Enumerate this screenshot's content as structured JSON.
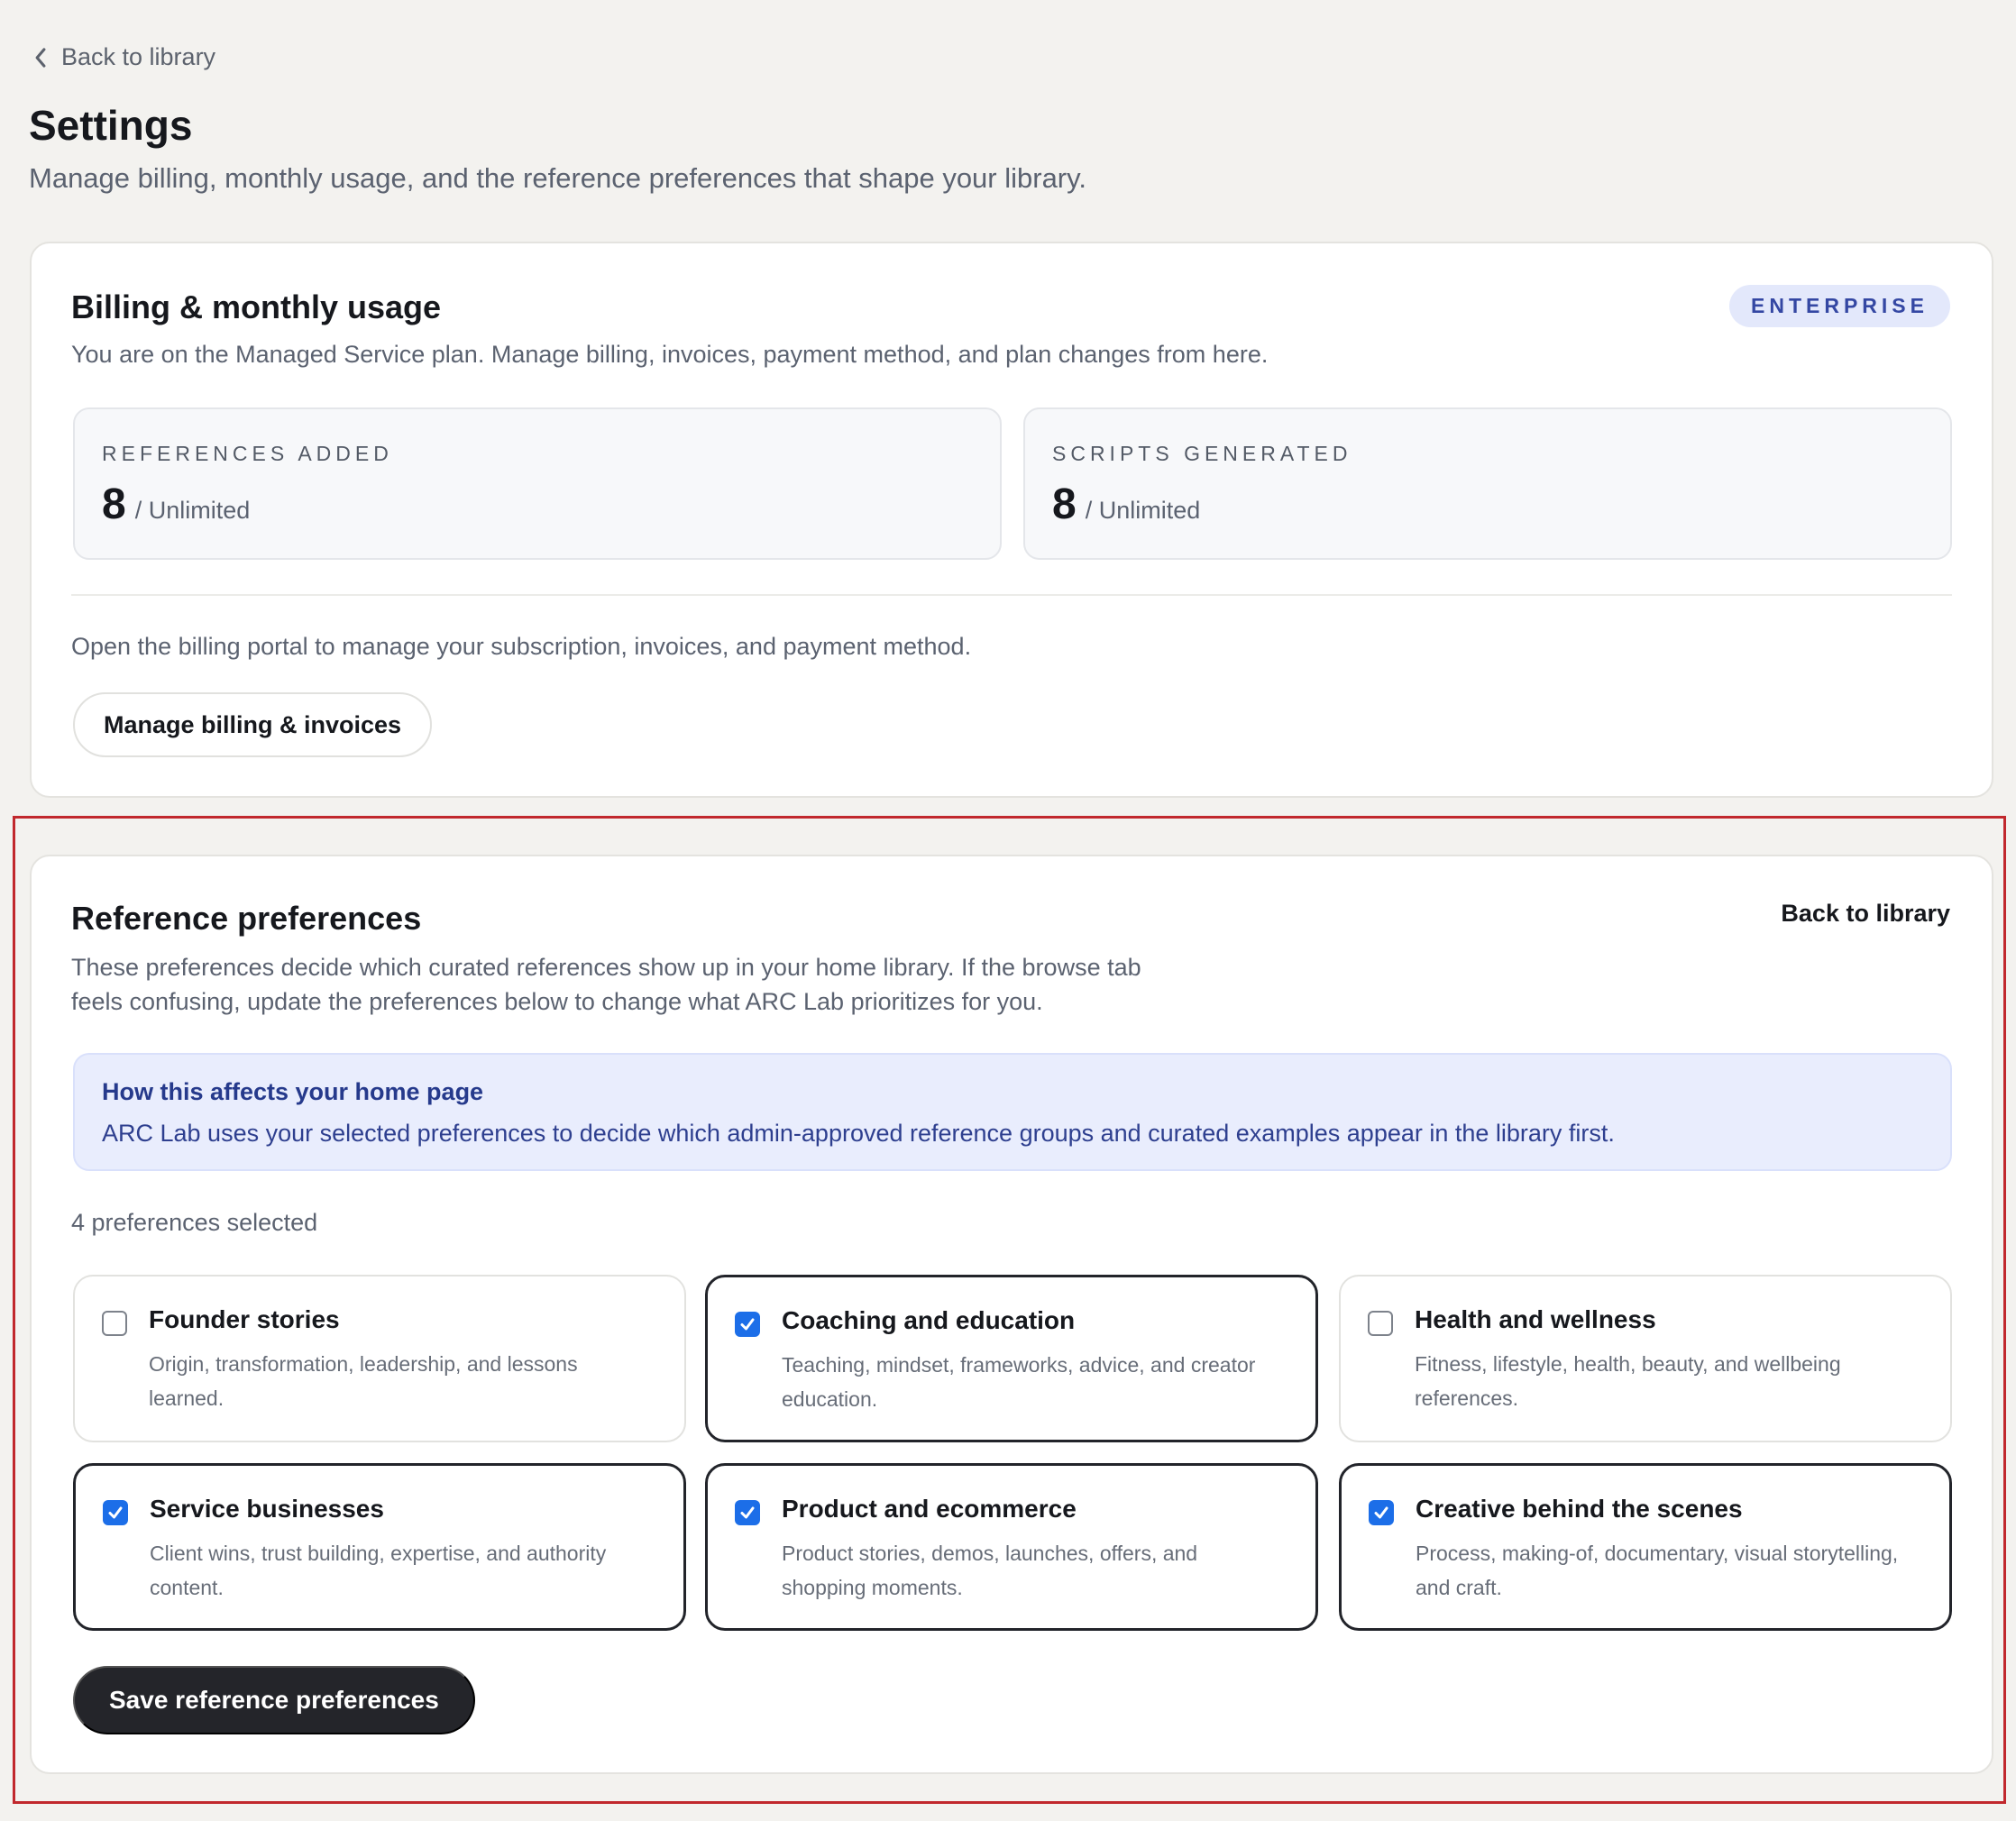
{
  "nav": {
    "back_label": "Back to library"
  },
  "header": {
    "title": "Settings",
    "subtitle": "Manage billing, monthly usage, and the reference preferences that shape your library."
  },
  "billing": {
    "title": "Billing & monthly usage",
    "plan_badge": "ENTERPRISE",
    "description": "You are on the Managed Service plan. Manage billing, invoices, payment method, and plan changes from here.",
    "stats": [
      {
        "label": "REFERENCES ADDED",
        "value": "8",
        "limit": "/ Unlimited"
      },
      {
        "label": "SCRIPTS GENERATED",
        "value": "8",
        "limit": "/ Unlimited"
      }
    ],
    "portal_text": "Open the billing portal to manage your subscription, invoices, and payment method.",
    "manage_button": "Manage billing & invoices"
  },
  "preferences": {
    "title": "Reference preferences",
    "back_link": "Back to library",
    "description_line1": "These preferences decide which curated references show up in your home library. If the browse tab",
    "description_line2": "feels confusing, update the preferences below to change what ARC Lab prioritizes for you.",
    "info": {
      "title": "How this affects your home page",
      "body": "ARC Lab uses your selected preferences to decide which admin-approved reference groups and curated examples appear in the library first."
    },
    "selected_count": "4 preferences selected",
    "options": [
      {
        "title": "Founder stories",
        "description": "Origin, transformation, leadership, and lessons learned.",
        "checked": false
      },
      {
        "title": "Coaching and education",
        "description": "Teaching, mindset, frameworks, advice, and creator education.",
        "checked": true
      },
      {
        "title": "Health and wellness",
        "description": "Fitness, lifestyle, health, beauty, and wellbeing references.",
        "checked": false
      },
      {
        "title": "Service businesses",
        "description": "Client wins, trust building, expertise, and authority content.",
        "checked": true
      },
      {
        "title": "Product and ecommerce",
        "description": "Product stories, demos, launches, offers, and shopping moments.",
        "checked": true
      },
      {
        "title": "Creative behind the scenes",
        "description": "Process, making-of, documentary, visual storytelling, and craft.",
        "checked": true
      }
    ],
    "save_button": "Save reference preferences"
  },
  "colors": {
    "accent_checkbox": "#1c6ee8",
    "badge_bg": "#e3e8fb",
    "badge_text": "#3447a3",
    "info_bg": "#e9edfd",
    "primary_button": "#24252a",
    "highlight_frame": "#c1282d"
  }
}
